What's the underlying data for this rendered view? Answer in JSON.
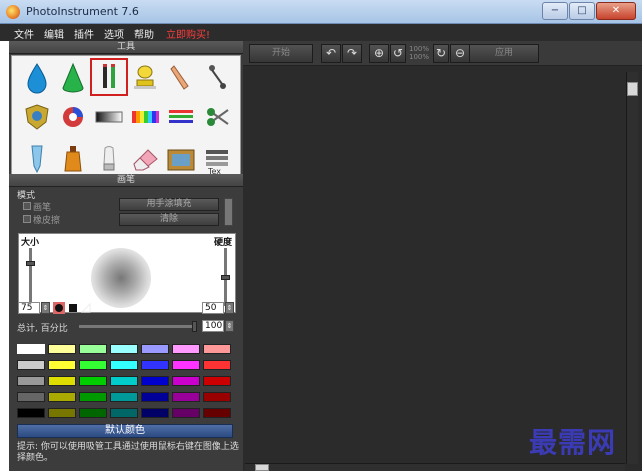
{
  "window": {
    "title": "PhotoInstrument 7.6",
    "minimize": "−",
    "restore": "□",
    "close": "✕"
  },
  "menu": {
    "items": [
      "文件",
      "编辑",
      "插件",
      "选项",
      "帮助"
    ],
    "promo": "立即购买!"
  },
  "tools_panel": {
    "title": "工具"
  },
  "brush_panel": {
    "title": "画笔",
    "mode_label": "模式",
    "mode_brush": "画笔",
    "mode_eraser": "橡皮擦",
    "fill_button": "用手涂填充",
    "clear_button": "清除",
    "size_label": "大小",
    "hardness_label": "硬度",
    "size_value": "75",
    "hardness_value": "50",
    "size_level": 0.75,
    "hardness_level": 0.5,
    "opacity_label": "总计, 百分比",
    "opacity_value": "100",
    "opacity_level": 1.0
  },
  "palette": {
    "colors": [
      [
        "#ffffff",
        "#ffff99",
        "#99ff99",
        "#99ffff",
        "#9999ff",
        "#ff99ff",
        "#ff9999"
      ],
      [
        "#cccccc",
        "#ffff33",
        "#33ff33",
        "#33ffff",
        "#3333ff",
        "#ff33ff",
        "#ff3333"
      ],
      [
        "#999999",
        "#dddd00",
        "#00cc00",
        "#00cccc",
        "#0000cc",
        "#cc00cc",
        "#cc0000"
      ],
      [
        "#666666",
        "#aaaa00",
        "#009900",
        "#009999",
        "#000099",
        "#990099",
        "#990000"
      ],
      [
        "#000000",
        "#777700",
        "#006600",
        "#006666",
        "#000066",
        "#660066",
        "#660000"
      ]
    ],
    "default_button": "默认颜色",
    "hint": "提示: 你可以使用吸管工具通过使用鼠标右键在图像上选择颜色。"
  },
  "toolbar": {
    "start_button": "开始",
    "apply_button": "应用",
    "undo_icon": "undo-arrow-icon",
    "redo_icon": "redo-arrow-icon",
    "zoom_in_icon": "zoom-in-icon",
    "zoom_out_icon": "zoom-out-icon",
    "zoom_a": "100%",
    "zoom_b": "100%"
  },
  "watermark": "最需网",
  "colors": {
    "panel": "#3c3c3c",
    "canvas": "#2b2b2b",
    "accent": "#2d4b83",
    "promo": "#ff3b3b"
  }
}
